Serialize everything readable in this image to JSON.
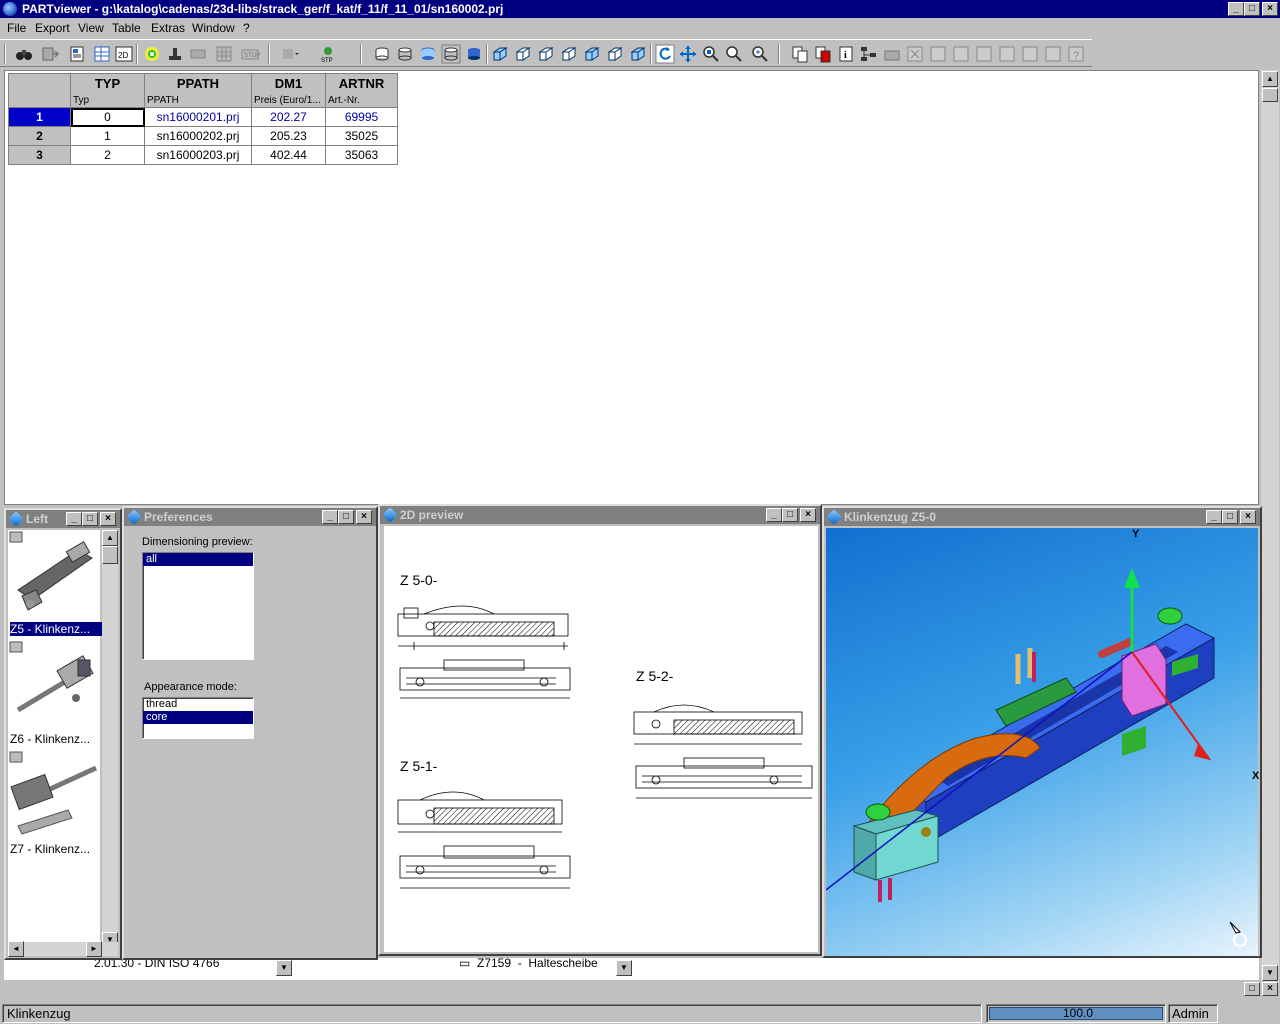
{
  "window": {
    "title": "PARTviewer - g:\\katalog\\cadenas/23d-libs/strack_ger/f_kat/f_11/f_11_01/sn160002.prj",
    "min_label": "_",
    "max_label": "□",
    "close_label": "×"
  },
  "menu": [
    "File",
    "Export",
    "View",
    "Table",
    "Extras",
    "Window",
    "?"
  ],
  "table": {
    "columns": [
      {
        "name": "TYP",
        "desc": "Typ"
      },
      {
        "name": "PPATH",
        "desc": "PPATH"
      },
      {
        "name": "DM1",
        "desc": "Preis (Euro/1..."
      },
      {
        "name": "ARTNR",
        "desc": "Art.-Nr."
      }
    ],
    "rows": [
      {
        "num": "1",
        "typ": "0",
        "ppath": "sn16000201.prj",
        "dm1": "202.27",
        "artnr": "69995"
      },
      {
        "num": "2",
        "typ": "1",
        "ppath": "sn16000202.prj",
        "dm1": "205.23",
        "artnr": "35025"
      },
      {
        "num": "3",
        "typ": "2",
        "ppath": "sn16000203.prj",
        "dm1": "402.44",
        "artnr": "35063"
      }
    ]
  },
  "left_window": {
    "title": "Left",
    "items": [
      "Z5 - Klinkenz...",
      "Z6 - Klinkenz...",
      "Z7 - Klinkenz..."
    ]
  },
  "preferences": {
    "title": "Preferences",
    "dim_label": "Dimensioning preview:",
    "dim_options": [
      "all"
    ],
    "appearance_label": "Appearance mode:",
    "appearance_options": [
      "thread",
      "core"
    ],
    "appearance_selected": "core"
  },
  "preview2d": {
    "title": "2D preview",
    "labels": [
      "Z 5-0-",
      "Z 5-2-",
      "Z 5-1-"
    ]
  },
  "view3d": {
    "title": "Klinkenzug Z5-0",
    "axis_y": "Y",
    "axis_x": "X"
  },
  "strip": {
    "left_text": "2.01.30 - DIN ISO 4766",
    "right_text": "Z7159  -  Haltescheibe"
  },
  "status": {
    "text": "Klinkenzug",
    "progress": "100.0",
    "user": "Admin"
  },
  "colors": {
    "titlebar": "#000080",
    "selection": "#000080",
    "blue_part": "#1e4fd8",
    "viewport_bg": "#1a8cd8"
  }
}
